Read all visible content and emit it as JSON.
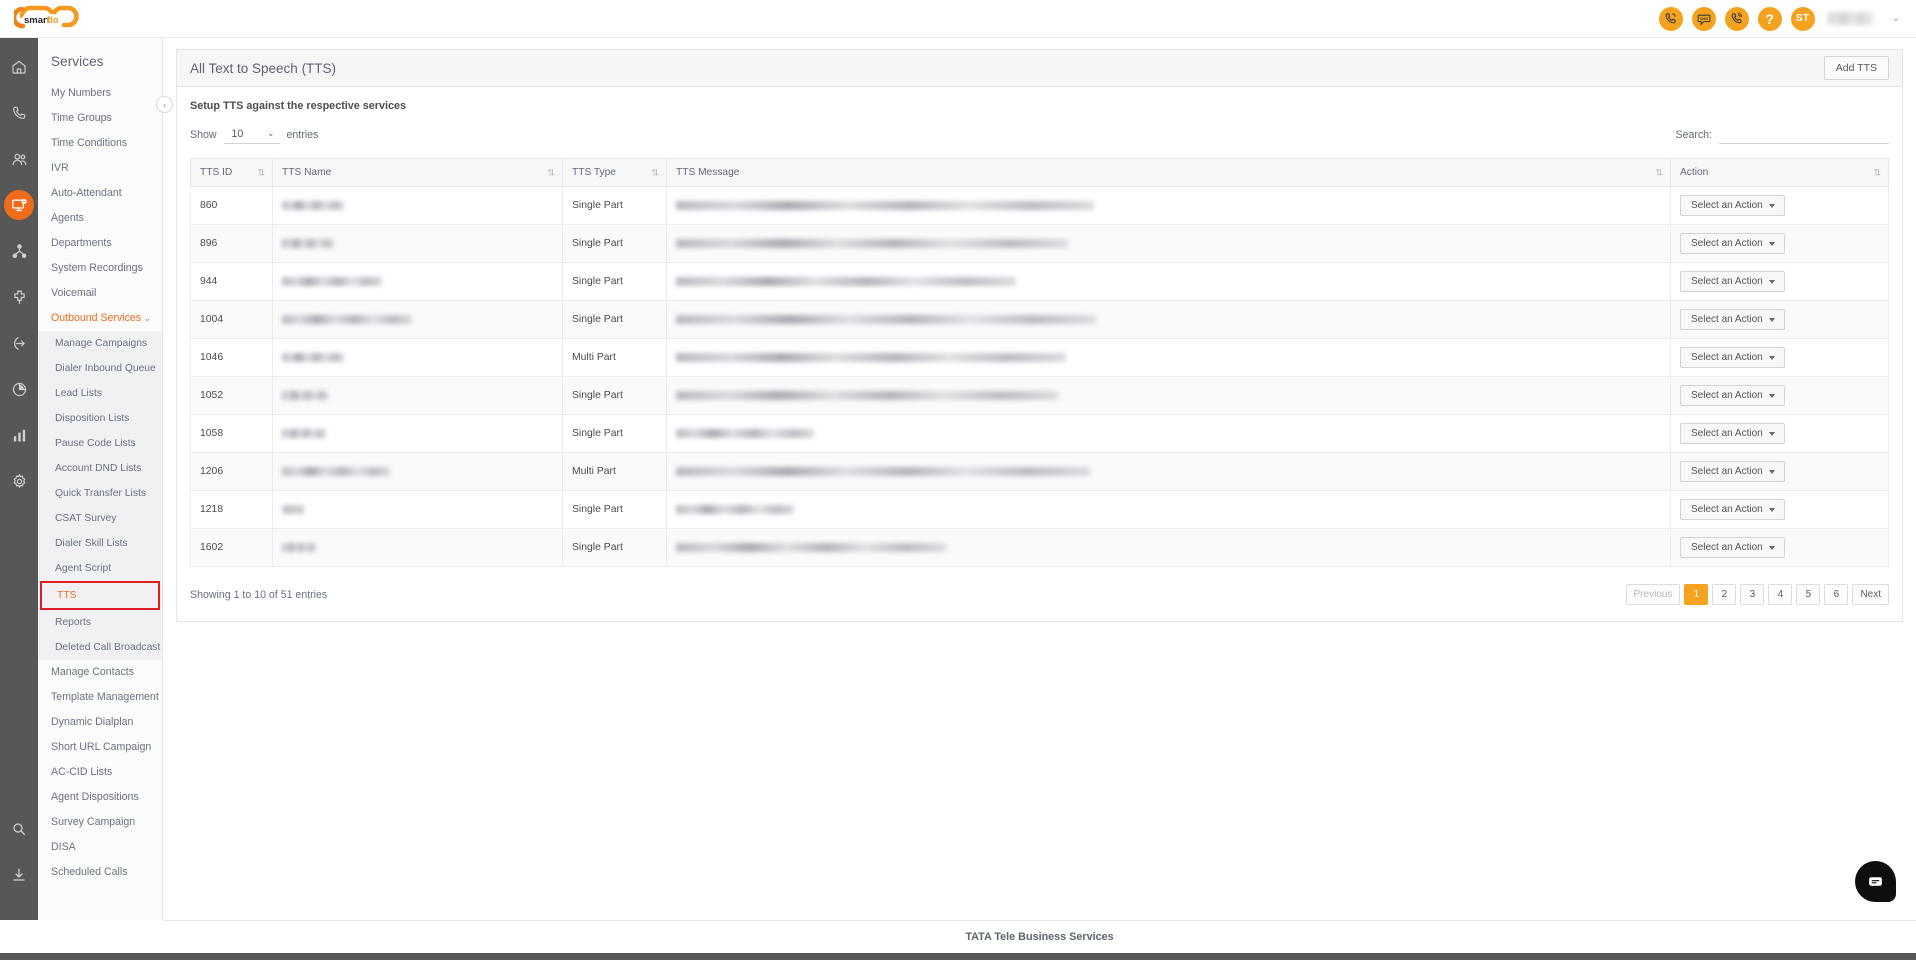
{
  "brand": {
    "name": "smartflo"
  },
  "topbar": {
    "icons": [
      {
        "name": "call-icon",
        "label": ""
      },
      {
        "name": "sms-icon",
        "label": "SMS"
      },
      {
        "name": "dialpad-call-icon",
        "label": ""
      },
      {
        "name": "help-icon",
        "label": "?"
      },
      {
        "name": "user-initials-avatar",
        "label": "ST"
      }
    ],
    "user_name": "",
    "chevron": "⌄"
  },
  "rail": {
    "items": [
      {
        "name": "home-icon",
        "active": false
      },
      {
        "name": "calls-icon",
        "active": false
      },
      {
        "name": "users-icon",
        "active": false
      },
      {
        "name": "services-monitor-icon",
        "active": true
      },
      {
        "name": "network-icon",
        "active": false
      },
      {
        "name": "integrations-icon",
        "active": false
      },
      {
        "name": "call-routing-icon",
        "active": false
      },
      {
        "name": "pie-chart-icon",
        "active": false
      },
      {
        "name": "bar-chart-icon",
        "active": false
      },
      {
        "name": "settings-gear-icon",
        "active": false
      }
    ],
    "bottom": [
      {
        "name": "search-icon"
      },
      {
        "name": "download-icon"
      }
    ]
  },
  "sidebar": {
    "title": "Services",
    "collapse_label": "‹",
    "items": [
      {
        "label": "My Numbers",
        "type": "item"
      },
      {
        "label": "Time Groups",
        "type": "item"
      },
      {
        "label": "Time Conditions",
        "type": "item"
      },
      {
        "label": "IVR",
        "type": "item"
      },
      {
        "label": "Auto-Attendant",
        "type": "item"
      },
      {
        "label": "Agents",
        "type": "item"
      },
      {
        "label": "Departments",
        "type": "item"
      },
      {
        "label": "System Recordings",
        "type": "item"
      },
      {
        "label": "Voicemail",
        "type": "item"
      },
      {
        "label": "Outbound Services",
        "type": "expand",
        "expanded": true
      },
      {
        "label": "Manage Campaigns",
        "type": "sub"
      },
      {
        "label": "Dialer Inbound Queue",
        "type": "sub"
      },
      {
        "label": "Lead Lists",
        "type": "sub"
      },
      {
        "label": "Disposition Lists",
        "type": "sub"
      },
      {
        "label": "Pause Code Lists",
        "type": "sub"
      },
      {
        "label": "Account DND Lists",
        "type": "sub"
      },
      {
        "label": "Quick Transfer Lists",
        "type": "sub"
      },
      {
        "label": "CSAT Survey",
        "type": "sub"
      },
      {
        "label": "Dialer Skill Lists",
        "type": "sub"
      },
      {
        "label": "Agent Script",
        "type": "sub"
      },
      {
        "label": "TTS",
        "type": "sub-highlighted"
      },
      {
        "label": "Reports",
        "type": "sub"
      },
      {
        "label": "Deleted Call Broadcast",
        "type": "sub"
      },
      {
        "label": "Manage Contacts",
        "type": "item"
      },
      {
        "label": "Template Management",
        "type": "item"
      },
      {
        "label": "Dynamic Dialplan",
        "type": "item"
      },
      {
        "label": "Short URL Campaign",
        "type": "item"
      },
      {
        "label": "AC-CID Lists",
        "type": "item"
      },
      {
        "label": "Agent Dispositions",
        "type": "item"
      },
      {
        "label": "Survey Campaign",
        "type": "item"
      },
      {
        "label": "DISA",
        "type": "item"
      },
      {
        "label": "Scheduled Calls",
        "type": "item"
      }
    ],
    "highlight_color": "#e02020",
    "accent_color": "#ef6c1a"
  },
  "panel": {
    "title": "All Text to Speech (TTS)",
    "add_button": "Add TTS",
    "subtitle": "Setup TTS against the respective services"
  },
  "controls": {
    "show_label": "Show",
    "entries_label": "entries",
    "page_length": "10",
    "chevron": "⌄",
    "search_label": "Search:",
    "search_value": "",
    "search_placeholder": ""
  },
  "table": {
    "columns": [
      {
        "label": "TTS ID",
        "sortable": true
      },
      {
        "label": "TTS Name",
        "sortable": true
      },
      {
        "label": "TTS Type",
        "sortable": true
      },
      {
        "label": "TTS Message",
        "sortable": true
      },
      {
        "label": "Action",
        "sortable": true
      }
    ],
    "action_button_label": "Select an Action",
    "rows": [
      {
        "id": "860",
        "name_redacted": true,
        "name_width": 62,
        "type": "Single Part",
        "msg_redacted": true,
        "msg_width": 418
      },
      {
        "id": "896",
        "name_redacted": true,
        "name_width": 52,
        "type": "Single Part",
        "msg_redacted": true,
        "msg_width": 392
      },
      {
        "id": "944",
        "name_redacted": true,
        "name_width": 100,
        "type": "Single Part",
        "msg_redacted": true,
        "msg_width": 340
      },
      {
        "id": "1004",
        "name_redacted": true,
        "name_width": 130,
        "type": "Single Part",
        "msg_redacted": true,
        "msg_width": 420
      },
      {
        "id": "1046",
        "name_redacted": true,
        "name_width": 62,
        "type": "Multi Part",
        "msg_redacted": true,
        "msg_width": 390
      },
      {
        "id": "1052",
        "name_redacted": true,
        "name_width": 46,
        "type": "Single Part",
        "msg_redacted": true,
        "msg_width": 382
      },
      {
        "id": "1058",
        "name_redacted": true,
        "name_width": 44,
        "type": "Single Part",
        "msg_redacted": true,
        "msg_width": 138
      },
      {
        "id": "1206",
        "name_redacted": true,
        "name_width": 108,
        "type": "Multi Part",
        "msg_redacted": true,
        "msg_width": 414
      },
      {
        "id": "1218",
        "name_redacted": true,
        "name_width": 22,
        "type": "Single Part",
        "msg_redacted": true,
        "msg_width": 118
      },
      {
        "id": "1602",
        "name_redacted": true,
        "name_width": 34,
        "type": "Single Part",
        "msg_redacted": true,
        "msg_width": 270
      }
    ]
  },
  "pagination": {
    "info": "Showing 1 to 10 of 51 entries",
    "previous": "Previous",
    "next": "Next",
    "pages": [
      "1",
      "2",
      "3",
      "4",
      "5",
      "6"
    ],
    "active_page": "1",
    "active_color": "#f5a31e"
  },
  "footer": {
    "text": "TATA Tele Business Services"
  },
  "chat": {
    "name": "chat-widget-button"
  }
}
